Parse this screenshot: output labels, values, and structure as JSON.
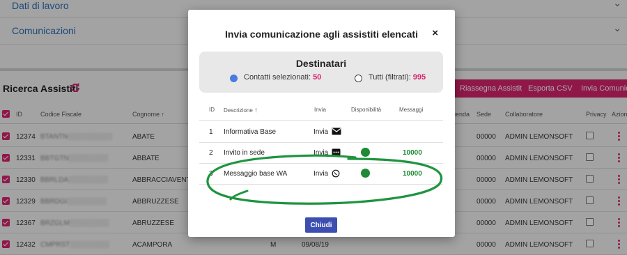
{
  "accordion": {
    "section1": "Dati di lavoro",
    "section2": "Comunicazioni"
  },
  "results": {
    "title": "Ricerca Assistiti",
    "buttons": [
      "Riassegna Assistiti",
      "Esporta CSV",
      "Invia Comunicaz"
    ],
    "columns": [
      "ID",
      "Codice Fiscale",
      "Cognome",
      "ienda",
      "Sede",
      "Collaboratore",
      "Privacy",
      "Azioni"
    ],
    "rows": [
      {
        "id": "12374",
        "cf": "BTANTN░░░░░░░░░",
        "cognome": "ABATE",
        "azienda": "",
        "sede": "00000",
        "collaboratore": "ADMIN LEMONSOFT"
      },
      {
        "id": "12331",
        "cf": "BBTGTN░░░░░░░░",
        "cognome": "ABBATE",
        "azienda": "",
        "sede": "00000",
        "collaboratore": "ADMIN LEMONSOFT"
      },
      {
        "id": "12330",
        "cf": "BBRLDA░░░░░░░░",
        "cognome": "ABBRACCIAVENTO",
        "azienda": "",
        "sede": "00000",
        "collaboratore": "ADMIN LEMONSOFT"
      },
      {
        "id": "12329",
        "cf": "BBRDGI░░░░░░░░",
        "cognome": "ABBRUZZESE",
        "azienda": "",
        "sede": "00000",
        "collaboratore": "ADMIN LEMONSOFT"
      },
      {
        "id": "12367",
        "cf": "BRZGLM░░░░░░░░",
        "cognome": "ABRUZZESE",
        "azienda": "",
        "sede": "00000",
        "collaboratore": "ADMIN LEMONSOFT"
      },
      {
        "id": "12432",
        "cf": "CMPRST░░░░░░░░",
        "cognome": "ACAMPORA",
        "azienda": "",
        "sede": "00000",
        "collaboratore": "ADMIN LEMONSOFT"
      }
    ],
    "last_row_extra": {
      "sex": "M",
      "date": "09/08/19"
    }
  },
  "modal": {
    "title": "Invia comunicazione agli assistiti elencati",
    "close": "×",
    "recipients": {
      "title": "Destinatari",
      "selected_label": "Contatti selezionati: ",
      "selected_count": "50",
      "all_label": "Tutti (filtrati): ",
      "all_count": "995"
    },
    "table": {
      "columns": [
        "ID",
        "Descrizione",
        "Invia",
        "Disponibilità",
        "Messaggi"
      ],
      "rows": [
        {
          "id": "1",
          "descrizione": "Informativa Base",
          "invia": "Invia",
          "channel": "email-icon",
          "available": false,
          "messaggi": ""
        },
        {
          "id": "2",
          "descrizione": "Invito in sede",
          "invia": "Invia",
          "channel": "sms-icon",
          "available": true,
          "messaggi": "10000"
        },
        {
          "id": "3",
          "descrizione": "Messaggio base WA",
          "invia": "Invia",
          "channel": "whatsapp-icon",
          "available": true,
          "messaggi": "10000"
        }
      ]
    },
    "close_button": "Chiudi"
  },
  "colors": {
    "accent": "#d6246e",
    "primary_button": "#3c4fb1",
    "available": "#1e8a36",
    "annotation": "#1e9440"
  }
}
